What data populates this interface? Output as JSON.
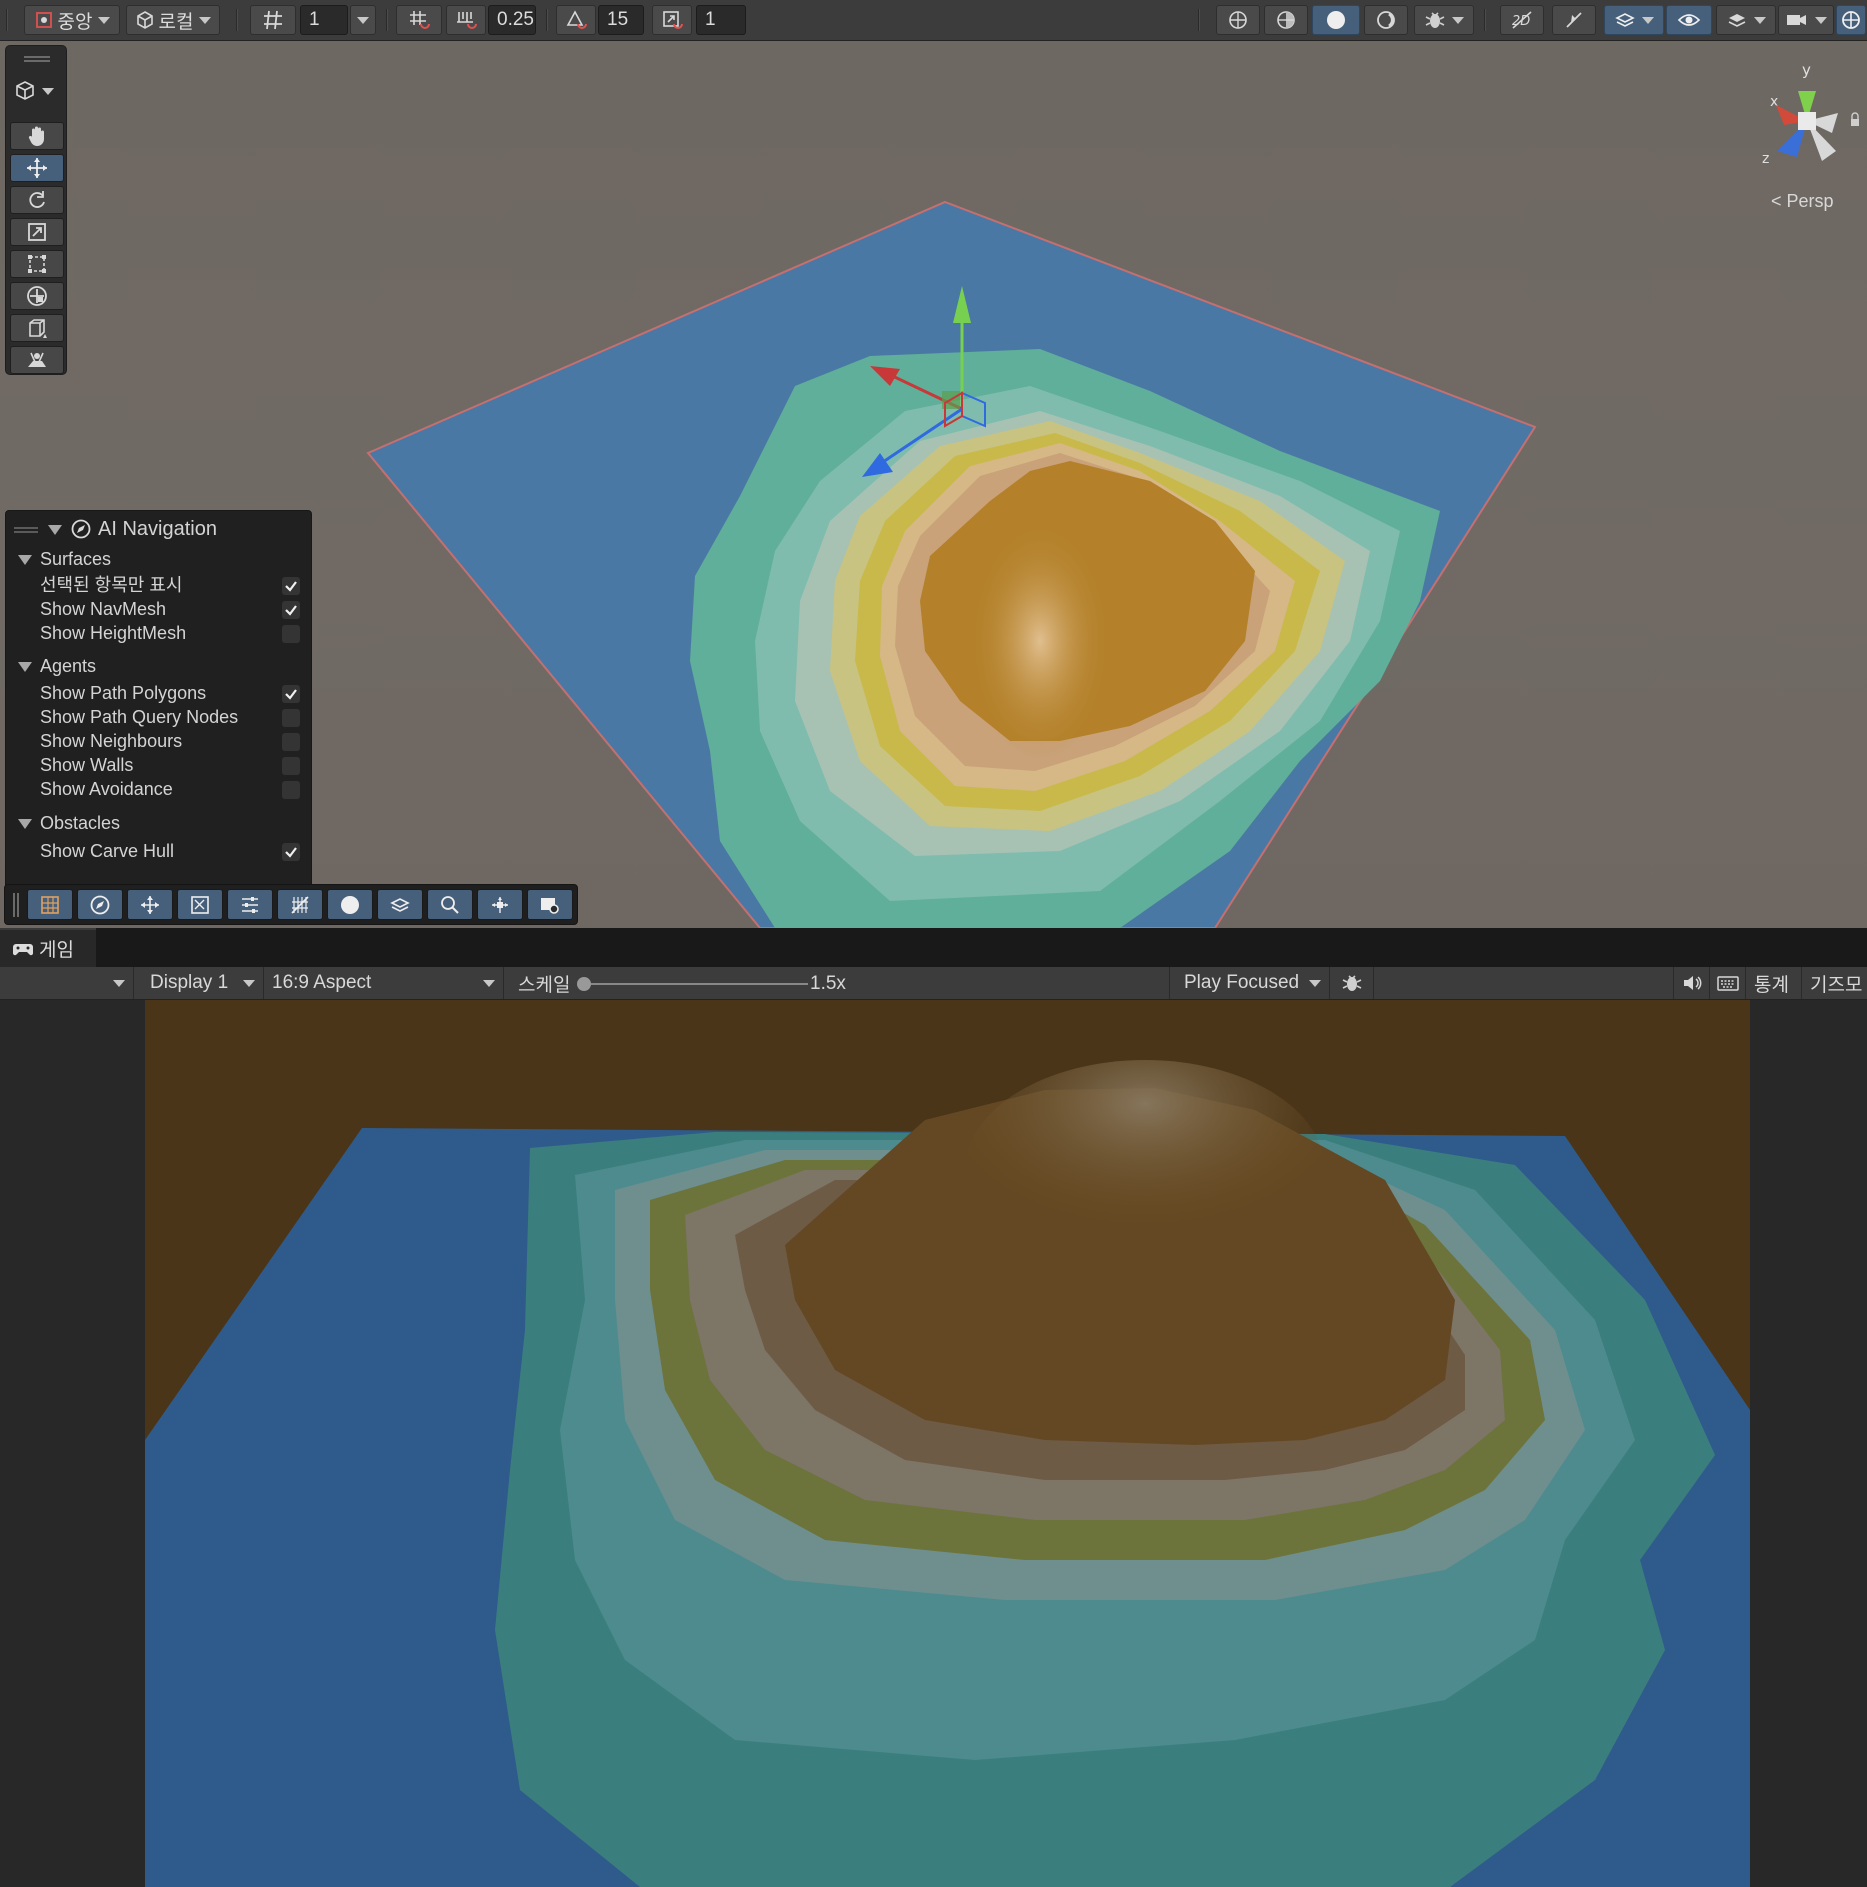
{
  "scene_toolbar": {
    "pivot_label": "중앙",
    "space_label": "로컬",
    "grid_size": "1",
    "snap_increment": "0.25",
    "rotation_snap": "15",
    "scale_snap": "1"
  },
  "tools_overlay": {
    "tools": [
      "view-tool",
      "move-tool",
      "rotate-tool",
      "scale-tool",
      "rect-tool",
      "transform-tool",
      "custom-tool",
      "navmesh-tool"
    ]
  },
  "orientation": {
    "y_label": "y",
    "x_label": "x",
    "z_label": "z",
    "persp_label": "< Persp"
  },
  "ai_navigation": {
    "title": "AI Navigation",
    "surfaces": {
      "label": "Surfaces",
      "items": [
        {
          "label": "선택된 항목만 표시",
          "checked": true
        },
        {
          "label": "Show NavMesh",
          "checked": true
        },
        {
          "label": "Show HeightMesh",
          "checked": false
        }
      ]
    },
    "agents": {
      "label": "Agents",
      "items": [
        {
          "label": "Show Path Polygons",
          "checked": true
        },
        {
          "label": "Show Path Query Nodes",
          "checked": false
        },
        {
          "label": "Show Neighbours",
          "checked": false
        },
        {
          "label": "Show Walls",
          "checked": false
        },
        {
          "label": "Show Avoidance",
          "checked": false
        }
      ]
    },
    "obstacles": {
      "label": "Obstacles",
      "items": [
        {
          "label": "Show Carve Hull",
          "checked": true
        }
      ]
    }
  },
  "game": {
    "tab_label": "게임",
    "display": "Display 1",
    "aspect": "16:9 Aspect",
    "scale_label": "스케일",
    "scale_value": "1.5x",
    "play_mode": "Play Focused",
    "stats_label": "통계",
    "gizmos_label": "기즈모"
  },
  "colors": {
    "accent": "#46607c",
    "water": "#4a78a5",
    "sand": "#b4812a",
    "grass": "#5faf9a"
  }
}
